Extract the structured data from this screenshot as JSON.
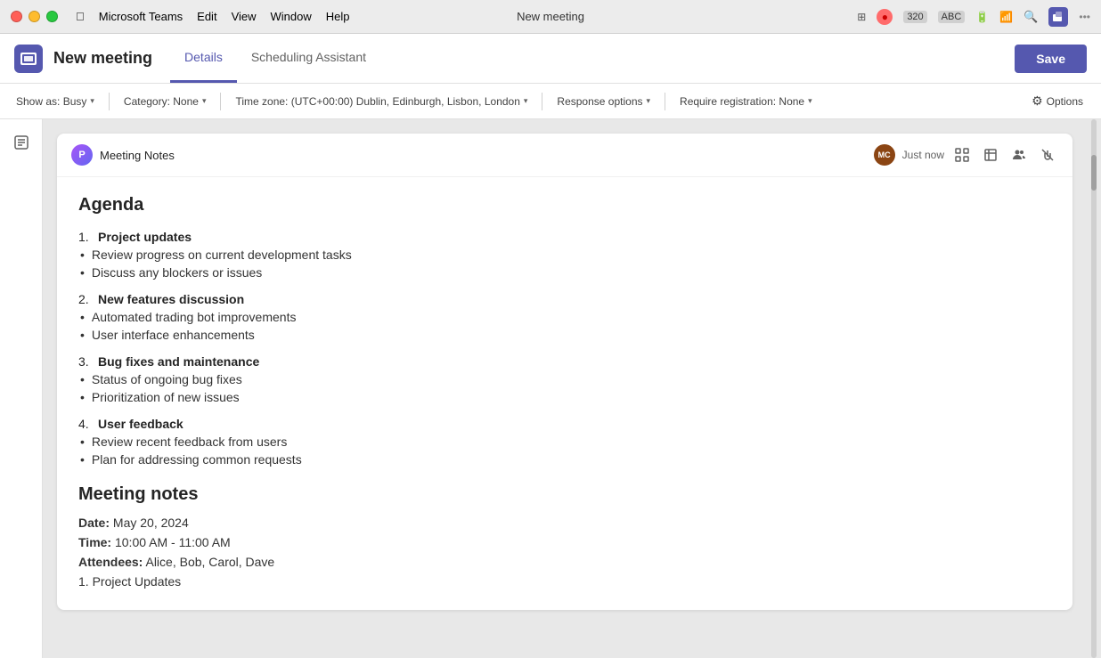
{
  "titlebar": {
    "title": "New meeting",
    "menu": [
      "Apple",
      "Microsoft Teams",
      "Edit",
      "View",
      "Window",
      "Help"
    ]
  },
  "header": {
    "meeting_title": "New meeting",
    "tabs": [
      "Details",
      "Scheduling Assistant"
    ],
    "active_tab": "Details",
    "save_button": "Save"
  },
  "toolbar": {
    "show_as": "Show as: Busy",
    "category": "Category: None",
    "time_zone": "Time zone: (UTC+00:00) Dublin, Edinburgh, Lisbon, London",
    "response_options": "Response options",
    "require_registration": "Require registration: None",
    "options": "Options"
  },
  "notes": {
    "tool_name": "Meeting Notes",
    "logo_text": "P",
    "avatar_initials": "MC",
    "timestamp": "Just now",
    "agenda_heading": "Agenda",
    "items": [
      {
        "num": "1.",
        "title": "Project updates",
        "bullets": [
          "Review progress on current development tasks",
          "Discuss any blockers or issues"
        ]
      },
      {
        "num": "2.",
        "title": "New features discussion",
        "bullets": [
          "Automated trading bot improvements",
          "User interface enhancements"
        ]
      },
      {
        "num": "3.",
        "title": "Bug fixes and maintenance",
        "bullets": [
          "Status of ongoing bug fixes",
          "Prioritization of new issues"
        ]
      },
      {
        "num": "4.",
        "title": "User feedback",
        "bullets": [
          "Review recent feedback from users",
          "Plan for addressing common requests"
        ]
      }
    ],
    "meeting_notes_heading": "Meeting notes",
    "date_label": "Date:",
    "date_value": "May 20, 2024",
    "time_label": "Time:",
    "time_value": "10:00 AM - 11:00 AM",
    "attendees_label": "Attendees:",
    "attendees_value": "Alice, Bob, Carol, Dave",
    "sub_item": "1. Project Updates"
  }
}
